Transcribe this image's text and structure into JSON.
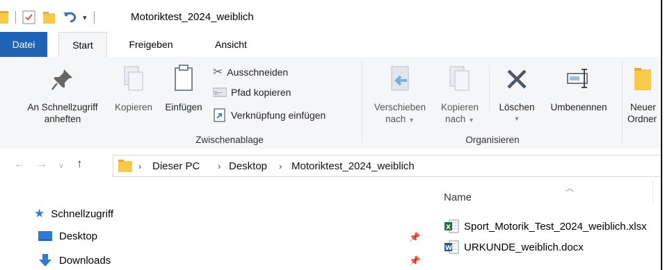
{
  "window": {
    "title": "Motoriktest_2024_weiblich"
  },
  "tabs": [
    {
      "label": "Datei"
    },
    {
      "label": "Start"
    },
    {
      "label": "Freigeben"
    },
    {
      "label": "Ansicht"
    }
  ],
  "ribbon": {
    "pin_label_1": "An Schnellzugriff",
    "pin_label_2": "anheften",
    "copy": "Kopieren",
    "paste": "Einfügen",
    "cut": "Ausschneiden",
    "copy_path": "Pfad kopieren",
    "paste_shortcut": "Verknüpfung einfügen",
    "clipboard_group": "Zwischenablage",
    "move_to_1": "Verschieben",
    "move_to_2": "nach",
    "copy_to_1": "Kopieren",
    "copy_to_2": "nach",
    "delete": "Löschen",
    "rename": "Umbenennen",
    "organize_group": "Organisieren",
    "new_folder_1": "Neuer",
    "new_folder_2": "Ordner"
  },
  "address": {
    "crumbs": [
      "Dieser PC",
      "Desktop",
      "Motoriktest_2024_weiblich"
    ]
  },
  "nav_pane": {
    "items": [
      {
        "label": "Schnellzugriff"
      },
      {
        "label": "Desktop"
      },
      {
        "label": "Downloads"
      }
    ]
  },
  "file_list": {
    "column_name": "Name",
    "files": [
      {
        "name": "Sport_Motorik_Test_2024_weiblich.xlsx"
      },
      {
        "name": "URKUNDE_weiblich.docx"
      }
    ]
  },
  "colors": {
    "file_tab": "#1e63b5",
    "folder": "#f8c94a",
    "excel": "#1d7044",
    "word": "#2b5797",
    "accent": "#2e7bd6"
  }
}
